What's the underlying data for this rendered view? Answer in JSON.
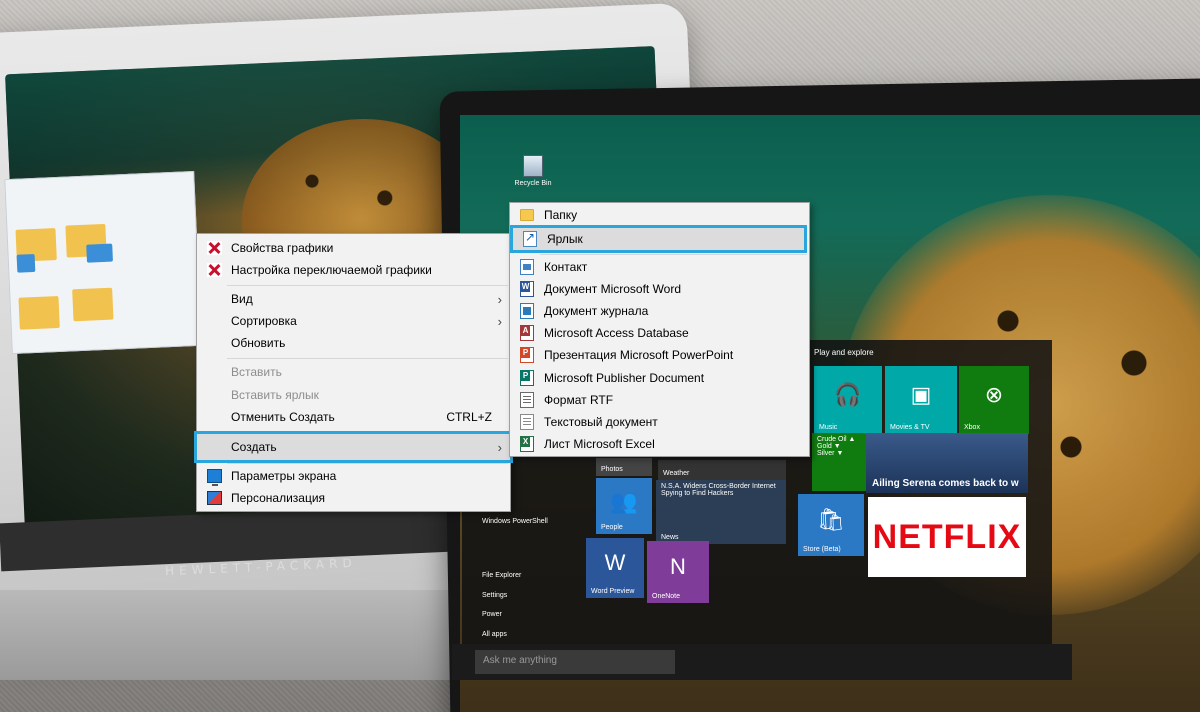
{
  "background": {
    "hp_brand": "HEWLETT-PACKARD",
    "recycle_bin_label": "Recycle Bin",
    "start_menu": {
      "section_label": "Play and explore",
      "left_items": [
        "Photos",
        "Weather",
        "Windows PowerShell",
        "File Explorer",
        "Settings",
        "Power",
        "All apps"
      ],
      "search_placeholder": "Ask me anything",
      "tiles": {
        "music": "Music",
        "movies": "Movies & TV",
        "xbox": "Xbox",
        "money_lines": "Crude Oil ▲\nGold ▼\nSilver ▼",
        "news_headline": "Ailing Serena comes back to w",
        "people": "People",
        "news": "News",
        "news_text": "N.S.A. Widens Cross-Border Internet Spying to Find Hackers",
        "store": "Store (Beta)",
        "word": "Word Preview",
        "onenote": "OneNote",
        "netflix": "NETFLIX"
      }
    }
  },
  "context_menu": {
    "items": [
      {
        "label": "Свойства графики",
        "icon": "graphics-icon"
      },
      {
        "label": "Настройка переключаемой графики",
        "icon": "graphics-icon"
      },
      {
        "label": "Вид",
        "submenu": true
      },
      {
        "label": "Сортировка",
        "submenu": true
      },
      {
        "label": "Обновить"
      },
      {
        "label": "Вставить",
        "disabled": true
      },
      {
        "label": "Вставить ярлык",
        "disabled": true
      },
      {
        "label": "Отменить Создать",
        "shortcut": "CTRL+Z"
      },
      {
        "label": "Создать",
        "submenu": true,
        "highlighted": true
      },
      {
        "label": "Параметры экрана",
        "icon": "display-icon"
      },
      {
        "label": "Персонализация",
        "icon": "personalization-icon"
      }
    ]
  },
  "new_submenu": {
    "items": [
      {
        "label": "Папку",
        "icon": "folder-icon"
      },
      {
        "label": "Ярлык",
        "icon": "shortcut-icon",
        "highlighted": true
      },
      {
        "label": "Контакт",
        "icon": "contact-icon"
      },
      {
        "label": "Документ Microsoft Word",
        "icon": "word-icon"
      },
      {
        "label": "Документ журнала",
        "icon": "journal-icon"
      },
      {
        "label": "Microsoft Access Database",
        "icon": "access-icon"
      },
      {
        "label": "Презентация Microsoft PowerPoint",
        "icon": "powerpoint-icon"
      },
      {
        "label": "Microsoft Publisher Document",
        "icon": "publisher-icon"
      },
      {
        "label": "Формат RTF",
        "icon": "rtf-icon"
      },
      {
        "label": "Текстовый документ",
        "icon": "text-document-icon"
      },
      {
        "label": "Лист Microsoft Excel",
        "icon": "excel-icon"
      }
    ]
  },
  "colors": {
    "highlight_outline": "#2aa6df",
    "menu_background": "#f2f2f2",
    "disabled_text": "#8d8d8d",
    "tile_teal": "#00a8a8",
    "tile_green": "#107c10",
    "tile_blue": "#2b78c4",
    "tile_purple": "#7f3c98",
    "netflix_red": "#e50914"
  }
}
